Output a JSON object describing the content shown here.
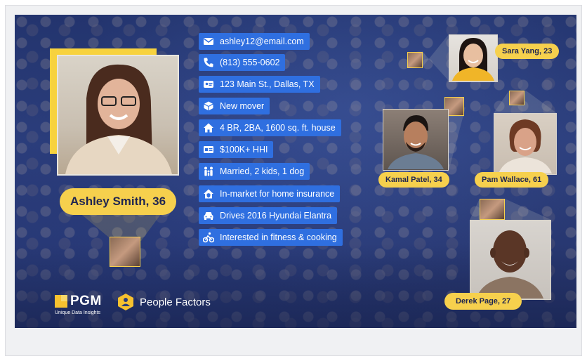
{
  "main_profile": {
    "name": "Ashley Smith, 36"
  },
  "attributes": [
    {
      "icon": "envelope-icon",
      "label": "ashley12@email.com"
    },
    {
      "icon": "phone-icon",
      "label": "(813) 555-0602"
    },
    {
      "icon": "address-card-icon",
      "label": "123 Main St., Dallas, TX"
    },
    {
      "icon": "box-icon",
      "label": "New mover"
    },
    {
      "icon": "house-icon",
      "label": "4 BR, 2BA, 1600 sq. ft. house"
    },
    {
      "icon": "id-card-icon",
      "label": "$100K+ HHI"
    },
    {
      "icon": "family-icon",
      "label": "Married, 2 kids, 1 dog"
    },
    {
      "icon": "house-shield-icon",
      "label": "In-market for home insurance"
    },
    {
      "icon": "car-icon",
      "label": "Drives 2016 Hyundai Elantra"
    },
    {
      "icon": "bike-icon",
      "label": "Interested in fitness & cooking"
    }
  ],
  "people": [
    {
      "name": "Sara Yang, 23"
    },
    {
      "name": "Kamal Patel, 34"
    },
    {
      "name": "Pam Wallace, 61"
    },
    {
      "name": "Derek Page, 27"
    }
  ],
  "logos": {
    "pgm_name": "PGM",
    "pgm_tagline": "Unique Data Insights",
    "people_factors": "People Factors"
  },
  "colors": {
    "background": "#26346b",
    "accent_yellow": "#f6d04d",
    "attribute_blue": "#2f6fe0"
  }
}
